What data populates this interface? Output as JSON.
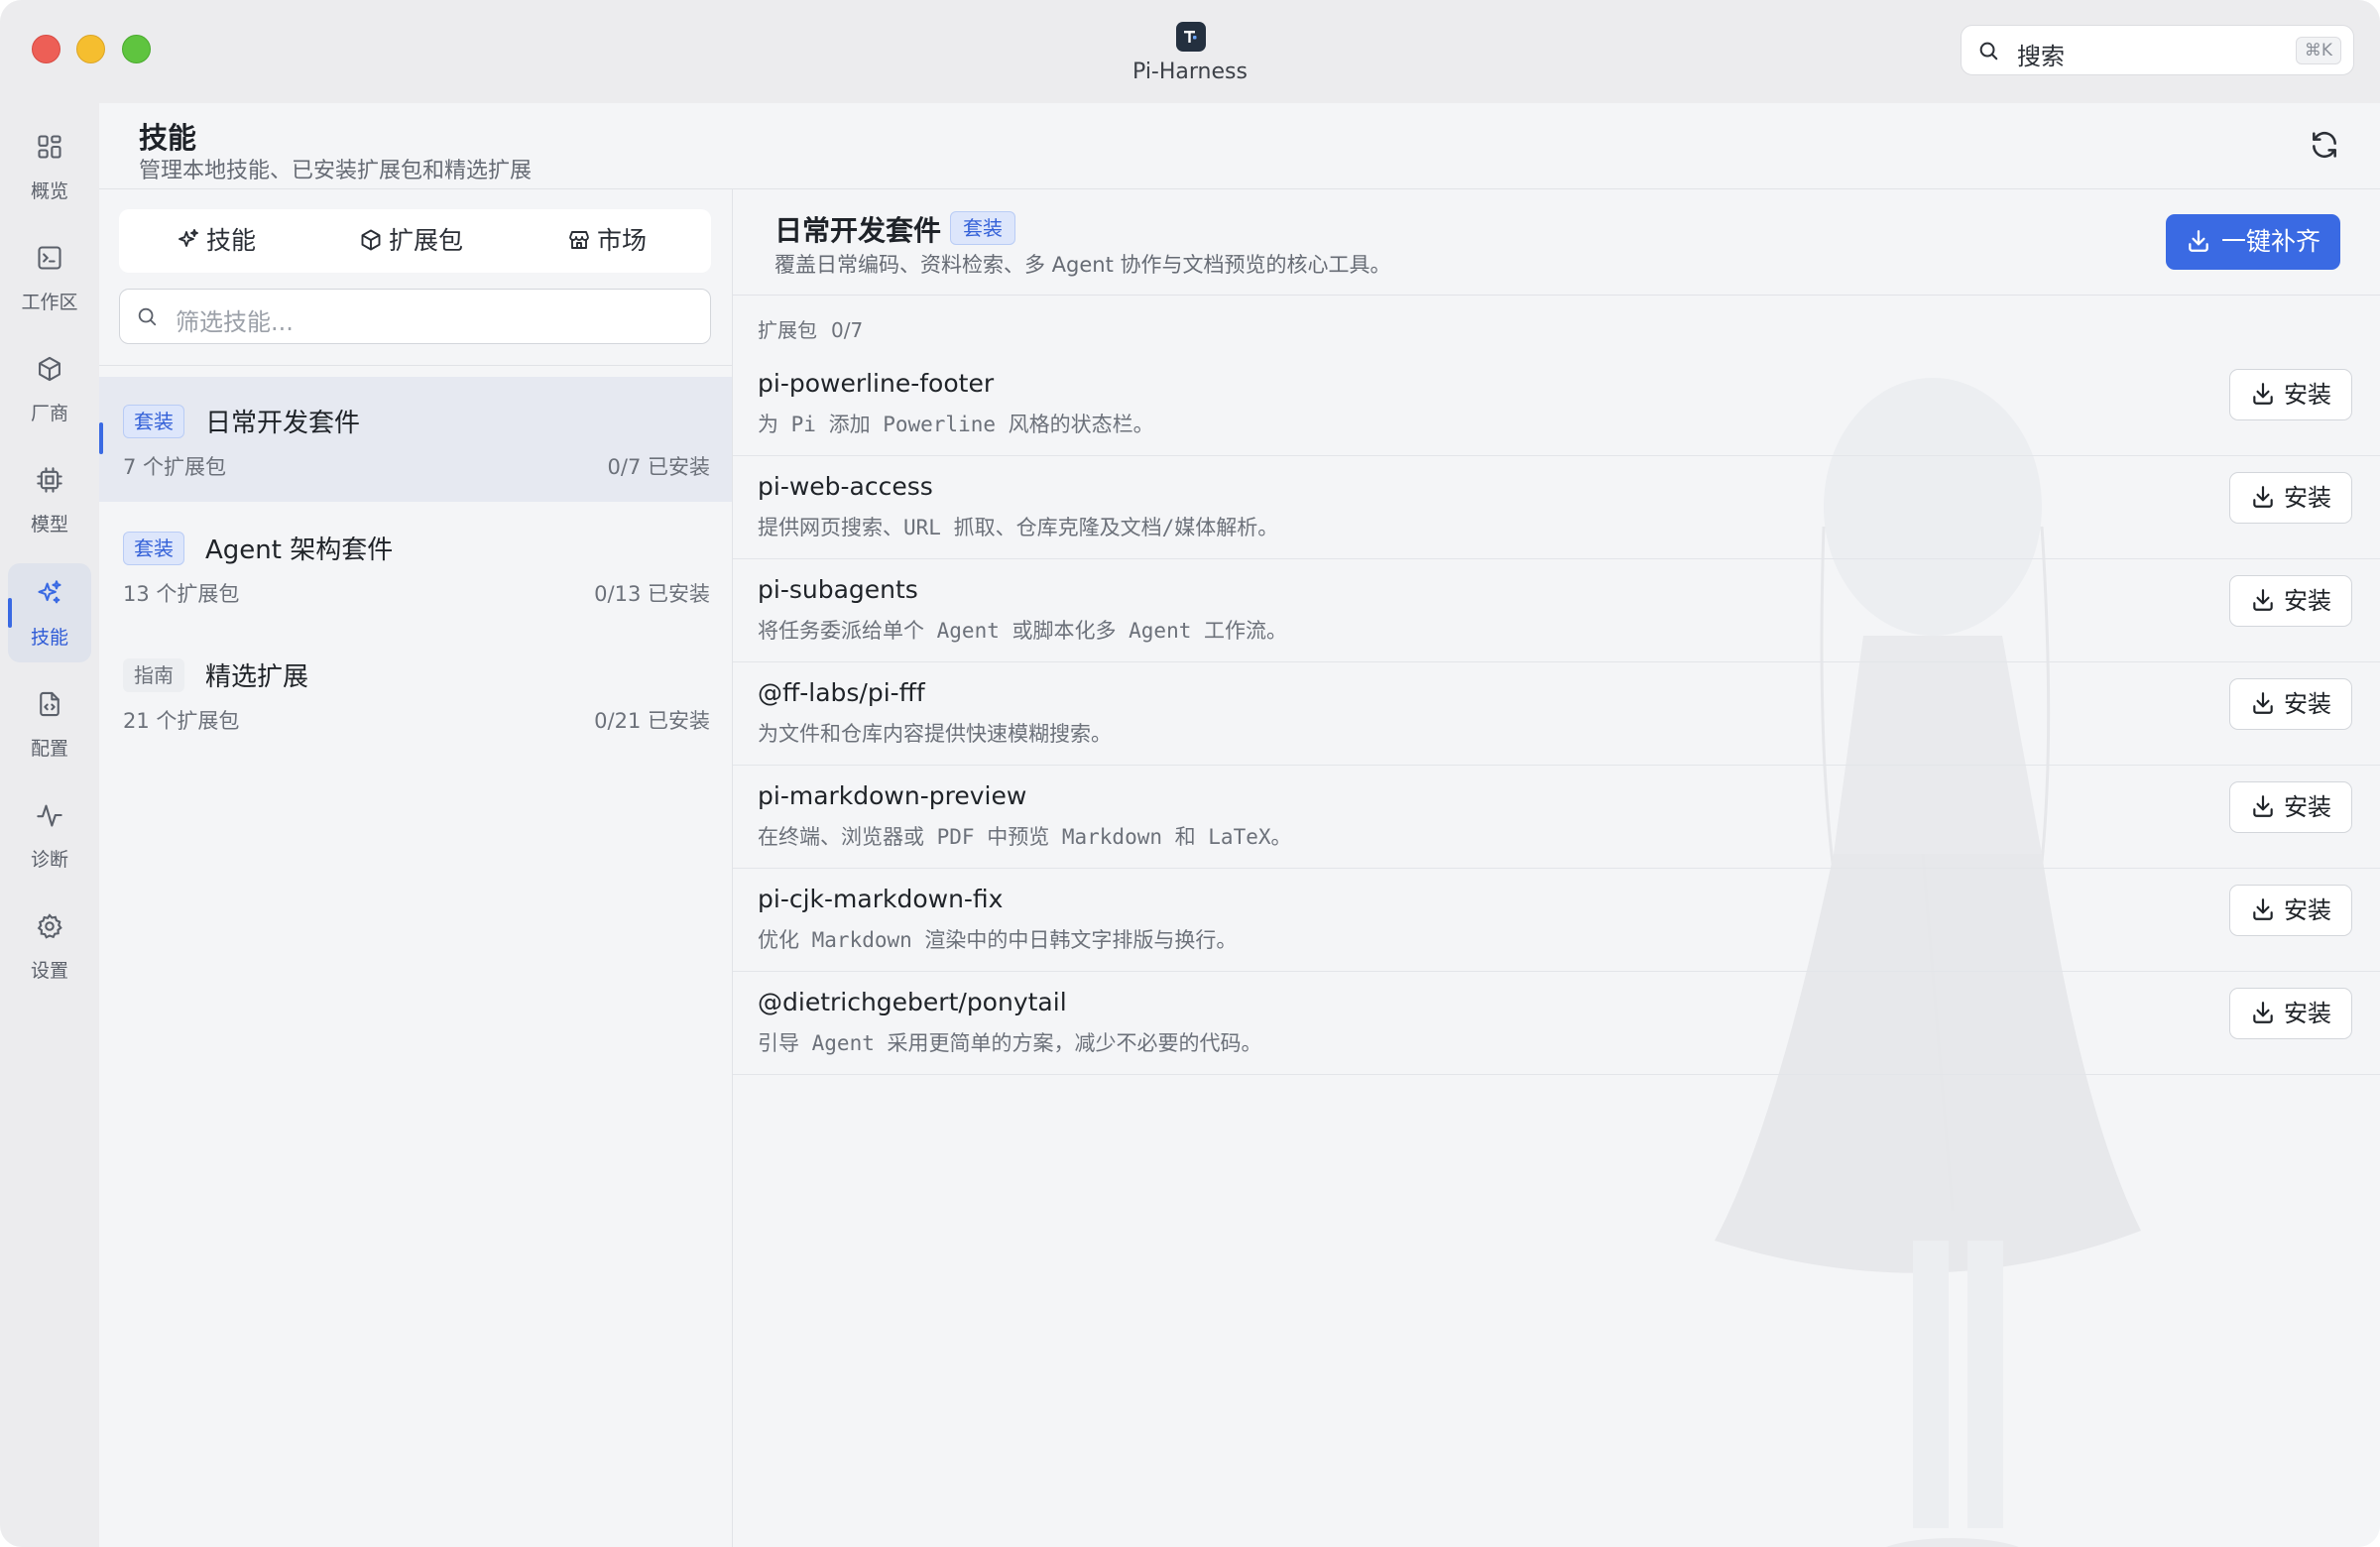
{
  "app": {
    "title": "Pi-Harness"
  },
  "search": {
    "placeholder": "搜索",
    "shortcut": "⌘K"
  },
  "rail": {
    "items": [
      {
        "label": "概览",
        "icon": "grid-icon"
      },
      {
        "label": "工作区",
        "icon": "terminal-icon"
      },
      {
        "label": "厂商",
        "icon": "cube-icon"
      },
      {
        "label": "模型",
        "icon": "chip-icon"
      },
      {
        "label": "技能",
        "icon": "sparkles-icon"
      },
      {
        "label": "配置",
        "icon": "file-code-icon"
      },
      {
        "label": "诊断",
        "icon": "activity-icon"
      },
      {
        "label": "设置",
        "icon": "gear-icon"
      }
    ],
    "active": "技能"
  },
  "header": {
    "title": "技能",
    "subtitle": "管理本地技能、已安装扩展包和精选扩展"
  },
  "tabs": [
    {
      "label": "技能",
      "icon": "sparkles-icon"
    },
    {
      "label": "扩展包",
      "icon": "package-icon"
    },
    {
      "label": "市场",
      "icon": "store-icon"
    }
  ],
  "filter": {
    "placeholder": "筛选技能..."
  },
  "suites": [
    {
      "badge": "套装",
      "name": "日常开发套件",
      "count": "7 个扩展包",
      "installed": "0/7 已安装"
    },
    {
      "badge": "套装",
      "name": "Agent 架构套件",
      "count": "13 个扩展包",
      "installed": "0/13 已安装"
    },
    {
      "badge": "指南",
      "name": "精选扩展",
      "count": "21 个扩展包",
      "installed": "0/21 已安装"
    }
  ],
  "detail": {
    "title": "日常开发套件",
    "badge": "套装",
    "description": "覆盖日常编码、资料检索、多 Agent 协作与文档预览的核心工具。",
    "fill_button": "一键补齐",
    "section_label": "扩展包",
    "section_count": "0/7",
    "install_label": "安装",
    "extensions": [
      {
        "name": "pi-powerline-footer",
        "desc": "为 Pi 添加 Powerline 风格的状态栏。"
      },
      {
        "name": "pi-web-access",
        "desc": "提供网页搜索、URL 抓取、仓库克隆及文档/媒体解析。"
      },
      {
        "name": "pi-subagents",
        "desc": "将任务委派给单个 Agent 或脚本化多 Agent 工作流。"
      },
      {
        "name": "@ff-labs/pi-fff",
        "desc": "为文件和仓库内容提供快速模糊搜索。"
      },
      {
        "name": "pi-markdown-preview",
        "desc": "在终端、浏览器或 PDF 中预览 Markdown 和 LaTeX。"
      },
      {
        "name": "pi-cjk-markdown-fix",
        "desc": "优化 Markdown 渲染中的中日韩文字排版与换行。"
      },
      {
        "name": "@dietrichgebert/ponytail",
        "desc": "引导 Agent 采用更简单的方案，减少不必要的代码。"
      }
    ]
  },
  "colors": {
    "accent": "#3a6ae3",
    "badge_bg": "#dde6fb",
    "badge_text": "#3461d8"
  }
}
